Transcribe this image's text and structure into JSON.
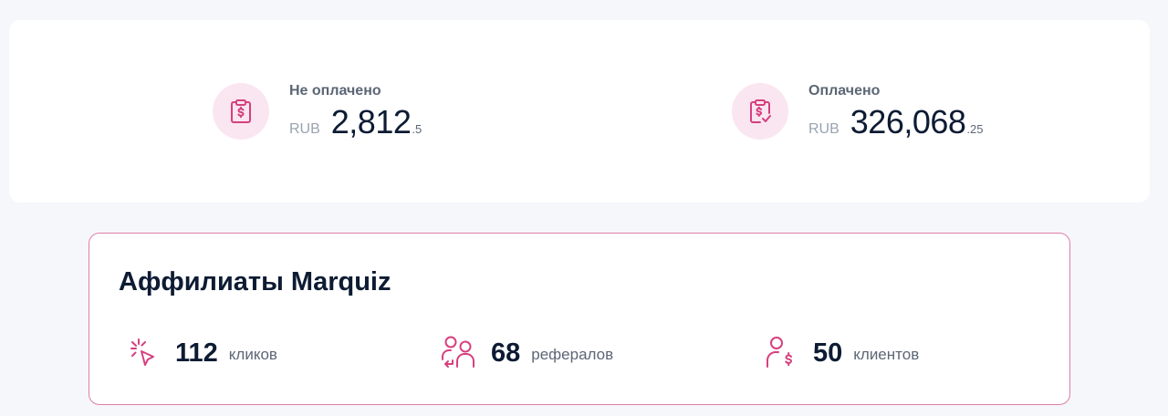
{
  "balances": {
    "unpaid": {
      "label": "Не оплачено",
      "currency": "RUB",
      "amount_int": "2,812",
      "amount_frac": ".5",
      "icon": "clipboard-dollar-icon"
    },
    "paid": {
      "label": "Оплачено",
      "currency": "RUB",
      "amount_int": "326,068",
      "amount_frac": ".25",
      "icon": "clipboard-check-icon"
    }
  },
  "affiliates": {
    "title": "Аффилиаты Marquiz",
    "metrics": {
      "clicks": {
        "value": "112",
        "label": "кликов",
        "icon": "cursor-click-icon"
      },
      "referrals": {
        "value": "68",
        "label": "рефералов",
        "icon": "users-icon"
      },
      "clients": {
        "value": "50",
        "label": "клиентов",
        "icon": "user-dollar-icon"
      }
    }
  },
  "colors": {
    "accent": "#d6407f",
    "icon_bg": "#fae6f0",
    "text_dark": "#0d1b33",
    "text_muted": "#5c6675",
    "card_border": "#de7fa6"
  }
}
